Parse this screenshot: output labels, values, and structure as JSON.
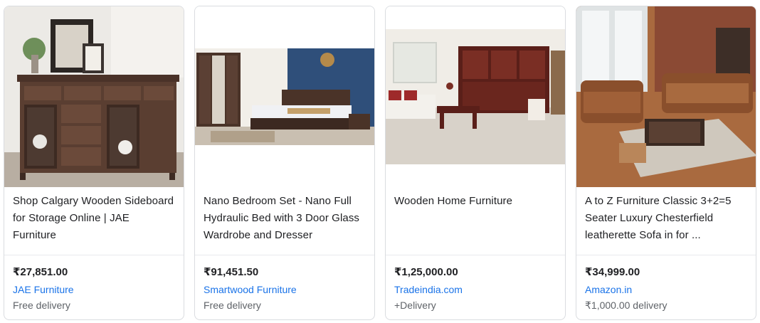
{
  "products": [
    {
      "image_alt": "wooden sideboard with cabinets",
      "title": "Shop Calgary Wooden Sideboard for Storage Online | JAE Furniture",
      "price": "₹27,851.00",
      "seller": "JAE Furniture",
      "delivery": "Free delivery"
    },
    {
      "image_alt": "bedroom set with wardrobe and bed",
      "title": "Nano Bedroom Set - Nano Full Hydraulic Bed with 3 Door Glass Wardrobe and Dresser",
      "title_display": "Nano Bedroom Set - Nano Full Hydraulic Bed with 3 Door Glass Wardrobe and Dresser",
      "price": "₹91,451.50",
      "seller": "Smartwood Furniture",
      "delivery": "Free delivery"
    },
    {
      "image_alt": "living room with wooden cabinets",
      "title": "Wooden Home Furniture",
      "price": "₹1,25,000.00",
      "seller": "Tradeindia.com",
      "delivery": "+Delivery"
    },
    {
      "image_alt": "brown chesterfield sofa set",
      "title": "A to Z Furniture Classic 3+2=5 Seater Luxury Chesterfield leatherette Sofa in for ...",
      "price": "₹34,999.00",
      "seller": "Amazon.in",
      "delivery": "₹1,000.00 delivery"
    }
  ],
  "colors": {
    "link": "#1a73e8",
    "muted": "#5f6368",
    "border": "#dadce0"
  }
}
